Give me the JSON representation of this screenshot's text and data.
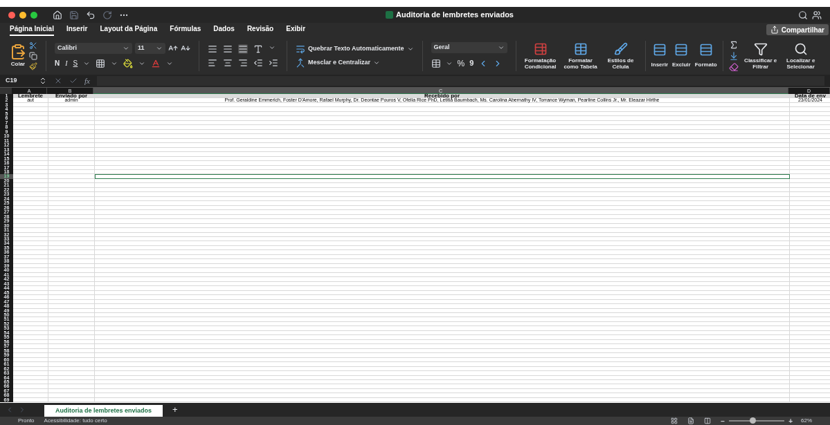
{
  "window": {
    "title": "Auditoria de lembretes enviados"
  },
  "ribbon_tabs": [
    {
      "label": "Página Inicial",
      "selected": true
    },
    {
      "label": "Inserir",
      "selected": false
    },
    {
      "label": "Layout da Página",
      "selected": false
    },
    {
      "label": "Fórmulas",
      "selected": false
    },
    {
      "label": "Dados",
      "selected": false
    },
    {
      "label": "Revisão",
      "selected": false
    },
    {
      "label": "Exibir",
      "selected": false
    }
  ],
  "share_button": "Compartilhar",
  "ribbon": {
    "paste": "Colar",
    "font_name": "Calibri",
    "font_size": "11",
    "bold": "N",
    "italic": "I",
    "underline": "S",
    "wrap_text": "Quebrar Texto Automaticamente",
    "merge": "Mesclar e Centralizar",
    "number_format": "Geral",
    "percent": "%",
    "comma": "9",
    "styles": [
      "Formatação Condicional",
      "Formatar como Tabela",
      "Estilos de Célula"
    ],
    "cells": [
      "Inserir",
      "Excluir",
      "Formato"
    ],
    "editing": [
      "Classificar e Filtrar",
      "Localizar e Selecionar"
    ]
  },
  "formula_bar": {
    "name_box": "C19",
    "fx": "fx"
  },
  "columns": [
    {
      "label": "A",
      "selected": false
    },
    {
      "label": "B",
      "selected": false
    },
    {
      "label": "C",
      "selected": true
    },
    {
      "label": "D",
      "selected": false
    }
  ],
  "rows": [
    {
      "kind": "header",
      "cells": [
        "Lembrete",
        "Enviado por",
        "Recebido por",
        "Data de env"
      ]
    },
    {
      "kind": "data",
      "cells": [
        "aut",
        "admin",
        "Prof. Geraldine Emmerich, Foster D'Amore, Rafael Murphy, Dr. Deontae Pouros V, Ofelia Rice PhD, Letitia Baumbach, Ms. Carolina Abernathy IV, Torrance Wyman, Pearline Collins Jr., Mr. Eleazar Hirthe",
        "23/01/2024"
      ]
    }
  ],
  "row_headers": [
    {
      "label": "1",
      "selected": false
    },
    {
      "label": "2",
      "selected": false
    },
    {
      "label": "3",
      "selected": false
    },
    {
      "label": "4",
      "selected": false
    },
    {
      "label": "5",
      "selected": false
    },
    {
      "label": "6",
      "selected": false
    },
    {
      "label": "7",
      "selected": false
    },
    {
      "label": "8",
      "selected": false
    },
    {
      "label": "9",
      "selected": false
    },
    {
      "label": "10",
      "selected": false
    },
    {
      "label": "11",
      "selected": false
    },
    {
      "label": "12",
      "selected": false
    },
    {
      "label": "13",
      "selected": false
    },
    {
      "label": "14",
      "selected": false
    },
    {
      "label": "15",
      "selected": false
    },
    {
      "label": "16",
      "selected": false
    },
    {
      "label": "17",
      "selected": false
    },
    {
      "label": "18",
      "selected": false
    },
    {
      "label": "19",
      "selected": true
    },
    {
      "label": "20",
      "selected": false
    },
    {
      "label": "21",
      "selected": false
    },
    {
      "label": "22",
      "selected": false
    },
    {
      "label": "23",
      "selected": false
    },
    {
      "label": "24",
      "selected": false
    },
    {
      "label": "25",
      "selected": false
    },
    {
      "label": "26",
      "selected": false
    },
    {
      "label": "27",
      "selected": false
    },
    {
      "label": "28",
      "selected": false
    },
    {
      "label": "29",
      "selected": false
    },
    {
      "label": "30",
      "selected": false
    },
    {
      "label": "31",
      "selected": false
    },
    {
      "label": "32",
      "selected": false
    },
    {
      "label": "33",
      "selected": false
    },
    {
      "label": "34",
      "selected": false
    },
    {
      "label": "35",
      "selected": false
    },
    {
      "label": "36",
      "selected": false
    },
    {
      "label": "37",
      "selected": false
    },
    {
      "label": "38",
      "selected": false
    },
    {
      "label": "39",
      "selected": false
    },
    {
      "label": "40",
      "selected": false
    },
    {
      "label": "41",
      "selected": false
    },
    {
      "label": "42",
      "selected": false
    },
    {
      "label": "43",
      "selected": false
    },
    {
      "label": "44",
      "selected": false
    },
    {
      "label": "45",
      "selected": false
    },
    {
      "label": "46",
      "selected": false
    },
    {
      "label": "47",
      "selected": false
    },
    {
      "label": "48",
      "selected": false
    },
    {
      "label": "49",
      "selected": false
    },
    {
      "label": "50",
      "selected": false
    },
    {
      "label": "51",
      "selected": false
    },
    {
      "label": "52",
      "selected": false
    },
    {
      "label": "53",
      "selected": false
    },
    {
      "label": "54",
      "selected": false
    },
    {
      "label": "55",
      "selected": false
    },
    {
      "label": "56",
      "selected": false
    },
    {
      "label": "57",
      "selected": false
    },
    {
      "label": "58",
      "selected": false
    },
    {
      "label": "59",
      "selected": false
    },
    {
      "label": "60",
      "selected": false
    },
    {
      "label": "61",
      "selected": false
    },
    {
      "label": "62",
      "selected": false
    },
    {
      "label": "63",
      "selected": false
    },
    {
      "label": "64",
      "selected": false
    },
    {
      "label": "65",
      "selected": false
    },
    {
      "label": "66",
      "selected": false
    },
    {
      "label": "67",
      "selected": false
    },
    {
      "label": "68",
      "selected": false
    },
    {
      "label": "69",
      "selected": false
    }
  ],
  "sheet_tabs": [
    {
      "label": "Auditoria de lembretes enviados",
      "selected": true
    }
  ],
  "add_sheet": "+",
  "status_bar": {
    "status": "Pronto",
    "accessibility": "Acessibilidade: tudo certo",
    "zoom": {
      "level": 0.42,
      "reading": "62%",
      "minus": "−",
      "plus": "+"
    }
  }
}
